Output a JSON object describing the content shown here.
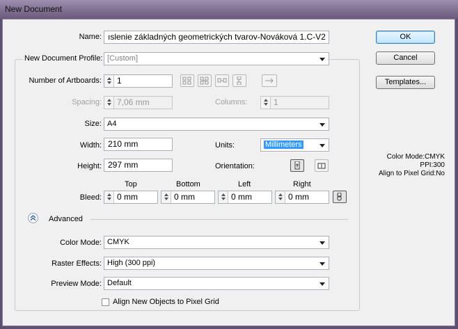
{
  "window": {
    "title": "New Document"
  },
  "name": {
    "label": "Name:",
    "value": "ıslenie základných geometrických tvarov-Nováková 1.C-V2"
  },
  "profile": {
    "label": "New Document Profile:",
    "value": "[Custom]"
  },
  "artboards": {
    "label": "Number of Artboards:",
    "value": "1"
  },
  "spacing": {
    "label": "Spacing:",
    "value": "7,06 mm"
  },
  "columns": {
    "label": "Columns:",
    "value": "1"
  },
  "size": {
    "label": "Size:",
    "value": "A4"
  },
  "width": {
    "label": "Width:",
    "value": "210 mm"
  },
  "units": {
    "label": "Units:",
    "value": "Millimeters"
  },
  "height": {
    "label": "Height:",
    "value": "297 mm"
  },
  "orientation": {
    "label": "Orientation:"
  },
  "bleed": {
    "label": "Bleed:",
    "top_label": "Top",
    "top": "0 mm",
    "bottom_label": "Bottom",
    "bottom": "0 mm",
    "left_label": "Left",
    "left": "0 mm",
    "right_label": "Right",
    "right": "0 mm"
  },
  "advanced": {
    "label": "Advanced"
  },
  "color_mode": {
    "label": "Color Mode:",
    "value": "CMYK"
  },
  "raster_effects": {
    "label": "Raster Effects:",
    "value": "High (300 ppi)"
  },
  "preview_mode": {
    "label": "Preview Mode:",
    "value": "Default"
  },
  "align_pixel_grid": {
    "label": "Align New Objects to Pixel Grid",
    "checked": false
  },
  "buttons": {
    "ok": "OK",
    "cancel": "Cancel",
    "templates": "Templates..."
  },
  "summary": {
    "color_mode": "Color Mode:CMYK",
    "ppi": "PPI:300",
    "align": "Align to Pixel Grid:No"
  },
  "colors": {
    "accent": "#3399ff",
    "frame": "#7c6d8f"
  }
}
